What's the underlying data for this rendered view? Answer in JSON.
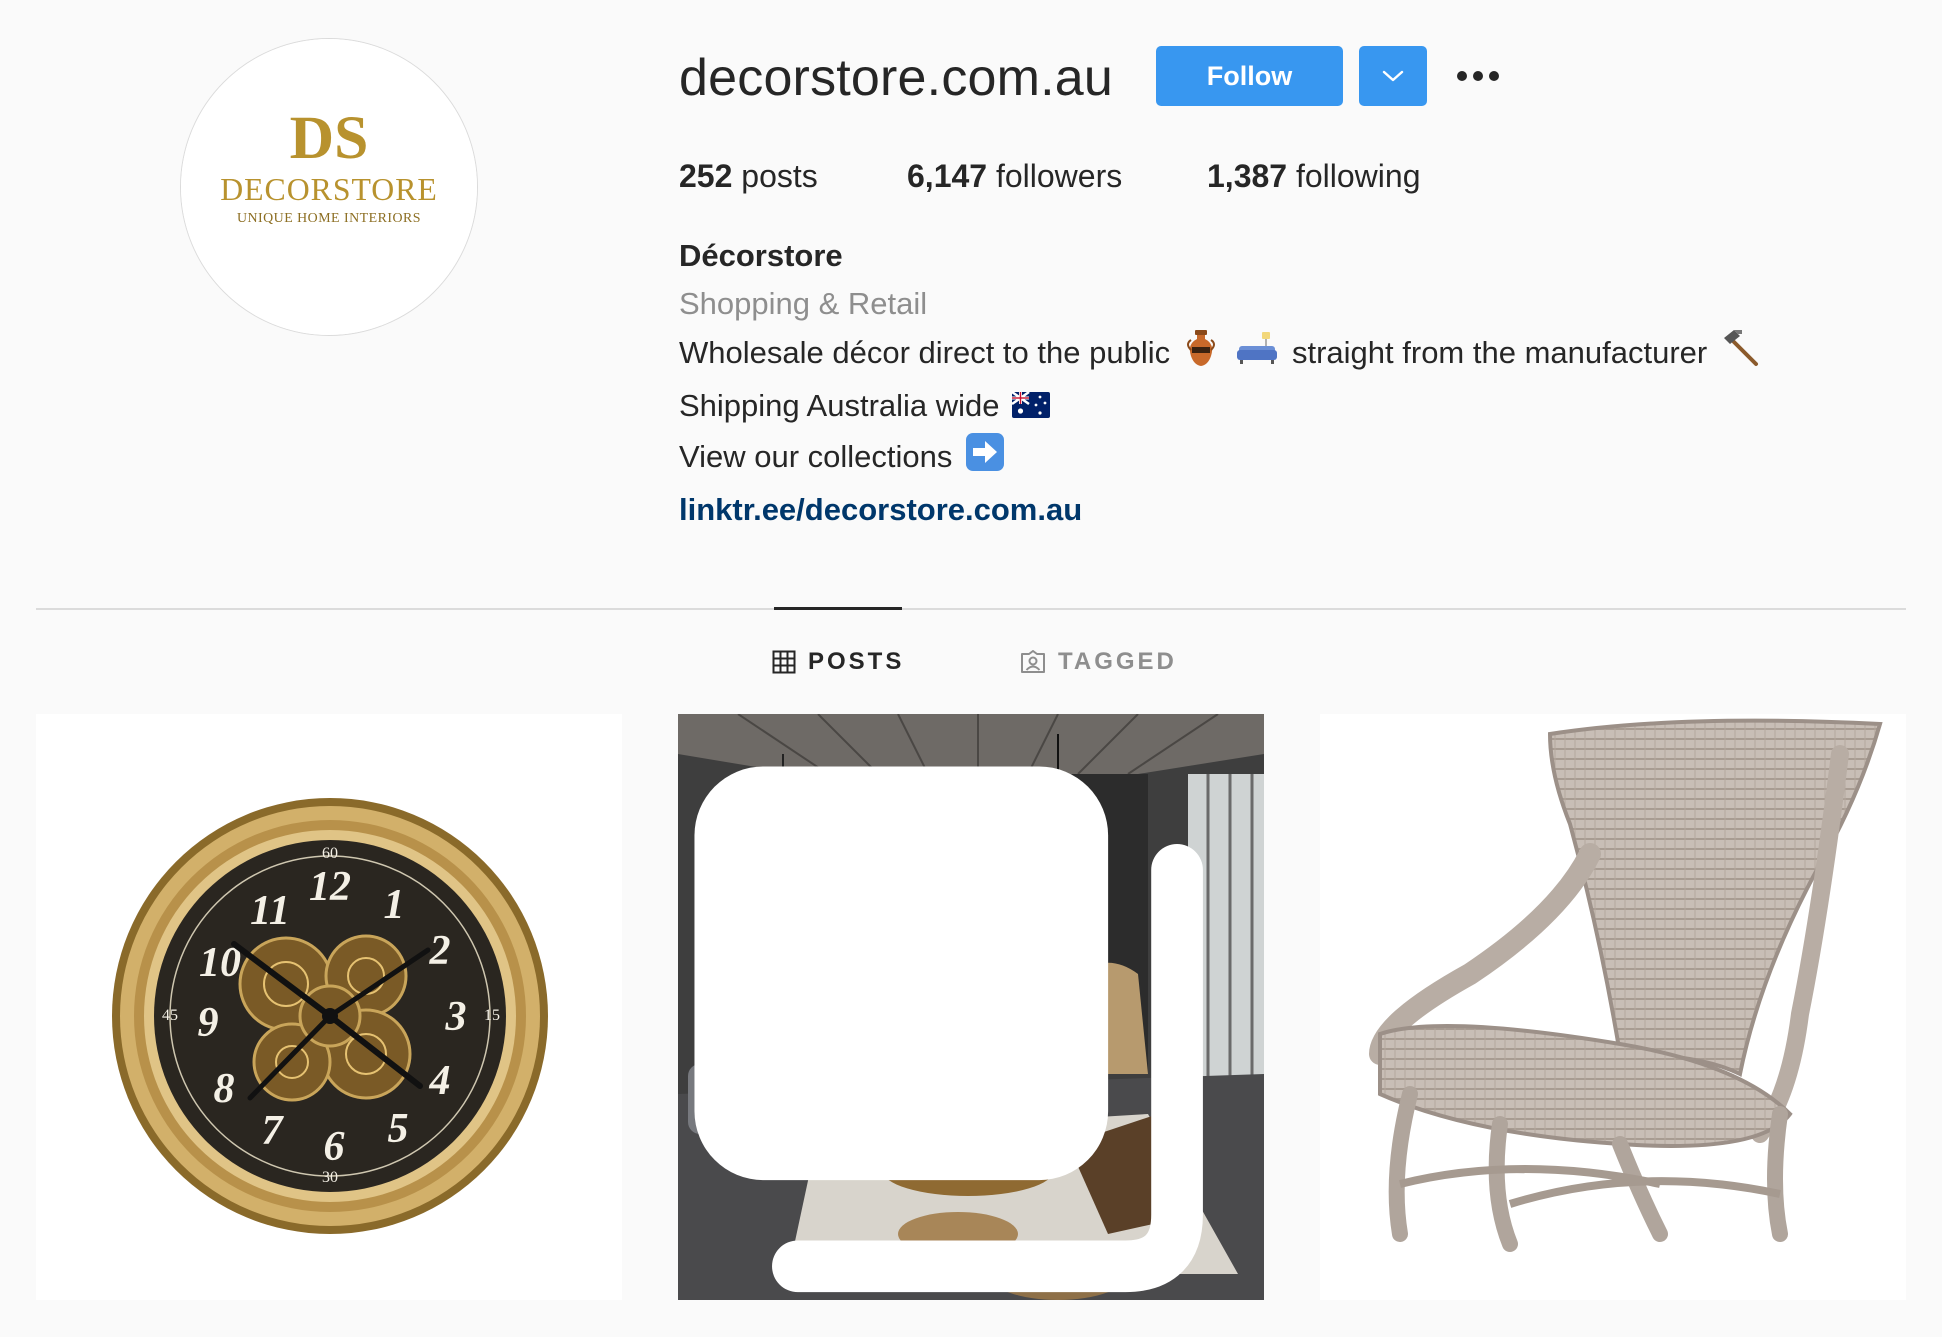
{
  "profile": {
    "username": "decorstore.com.au",
    "avatar": {
      "brand_mark": "DS",
      "brand_name": "DECORSTORE",
      "tagline": "UNIQUE HOME INTERIORS",
      "gold_color": "#b8922e"
    }
  },
  "actions": {
    "follow_label": "Follow",
    "accent_color": "#3897f0",
    "dropdown_icon": "chevron-down-icon",
    "more_icon": "more-options-icon"
  },
  "stats": {
    "posts_count": "252",
    "posts_label": "posts",
    "followers_count": "6,147",
    "followers_label": "followers",
    "following_count": "1,387",
    "following_label": "following"
  },
  "bio": {
    "name": "Décorstore",
    "category": "Shopping & Retail",
    "line1_a": "Wholesale décor direct to the public",
    "line1_b": "straight from the manufacturer",
    "line2": "Shipping Australia wide",
    "line3": "View our collections",
    "link": "linktr.ee/decorstore.com.au",
    "emoji_icons": [
      "amphora-icon",
      "couch-icon",
      "hammer-icon",
      "australia-flag-icon",
      "right-arrow-icon"
    ]
  },
  "tabs": [
    {
      "label": "POSTS",
      "icon": "grid-icon",
      "active": true
    },
    {
      "label": "TAGGED",
      "icon": "tagged-icon",
      "active": false
    }
  ],
  "posts": [
    {
      "subject": "gear-wall-clock-image"
    },
    {
      "subject": "living-room-image",
      "multi": true
    },
    {
      "subject": "wicker-chair-image"
    }
  ],
  "clock_numerals": {
    "hours": [
      "12",
      "1",
      "2",
      "3",
      "4",
      "5",
      "6",
      "7",
      "8",
      "9",
      "10",
      "11"
    ],
    "minutes": [
      "60",
      "15",
      "30",
      "45"
    ]
  }
}
